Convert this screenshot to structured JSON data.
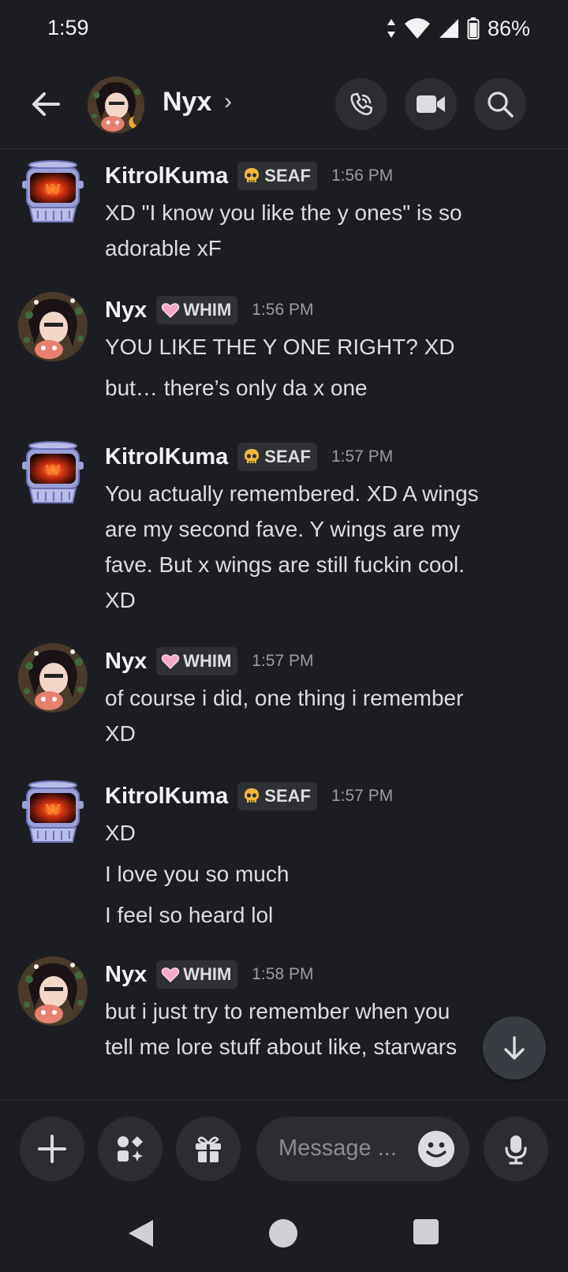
{
  "status": {
    "time": "1:59",
    "battery": "86%"
  },
  "header": {
    "name": "Nyx"
  },
  "colors": {
    "background": "#1c1d22",
    "panel": "#2b2d31",
    "muted": "#9a9ba2"
  },
  "messages": [
    {
      "author": "KitrolKuma",
      "tag": "SEAF",
      "tag_icon": "skull-icon",
      "time": "1:56 PM",
      "lines": [
        "XD \"I know you like the y ones\" is so",
        "adorable xF"
      ]
    },
    {
      "author": "Nyx",
      "tag": "WHIM",
      "tag_icon": "heart-icon",
      "time": "1:56 PM",
      "lines": [
        "YOU LIKE THE Y ONE RIGHT? XD"
      ],
      "extra": [
        "but… there’s only da x one"
      ]
    },
    {
      "author": "KitrolKuma",
      "tag": "SEAF",
      "tag_icon": "skull-icon",
      "time": "1:57 PM",
      "lines": [
        "You actually remembered. XD A wings",
        "are my second fave. Y wings are my",
        "fave. But x wings are still fuckin cool.",
        "XD"
      ]
    },
    {
      "author": "Nyx",
      "tag": "WHIM",
      "tag_icon": "heart-icon",
      "time": "1:57 PM",
      "lines": [
        "of course i did, one thing i remember",
        "XD"
      ]
    },
    {
      "author": "KitrolKuma",
      "tag": "SEAF",
      "tag_icon": "skull-icon",
      "time": "1:57 PM",
      "lines": [
        "XD"
      ],
      "extra": [
        "I love you so much",
        "I feel so heard lol"
      ]
    },
    {
      "author": "Nyx",
      "tag": "WHIM",
      "tag_icon": "heart-icon",
      "time": "1:58 PM",
      "lines": [
        "but i just try to remember when you",
        "tell me lore stuff about like, starwars"
      ]
    }
  ],
  "composer": {
    "placeholder": "Message ..."
  }
}
